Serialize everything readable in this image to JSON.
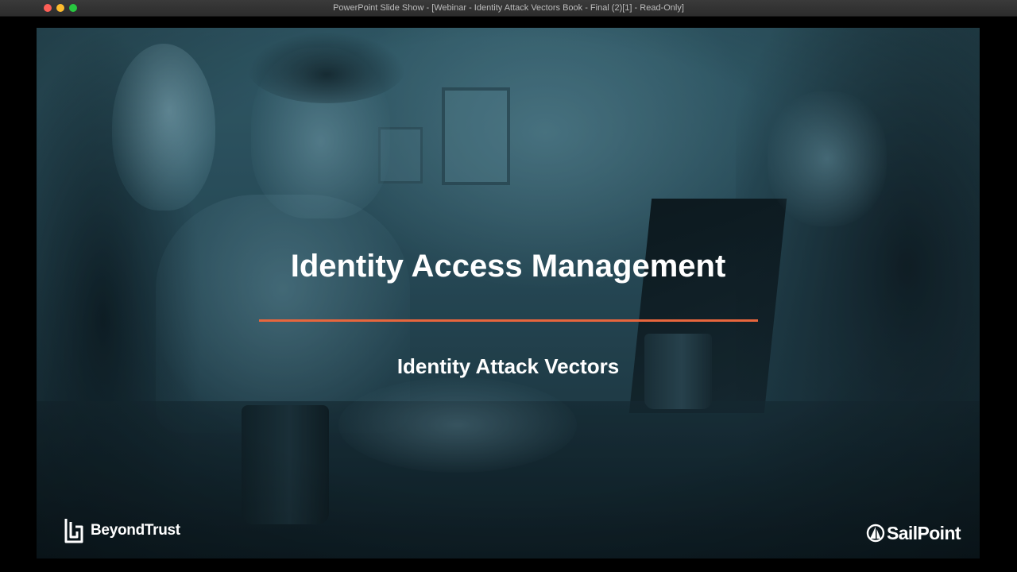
{
  "window": {
    "title": "PowerPoint Slide Show - [Webinar - Identity Attack Vectors Book - Final (2)[1]  -  Read-Only]"
  },
  "slide": {
    "title": "Identity Access Management",
    "subtitle": "Identity Attack Vectors",
    "accent_color": "#e8663d",
    "logos": {
      "left": "BeyondTrust",
      "right": "SailPoint"
    }
  }
}
